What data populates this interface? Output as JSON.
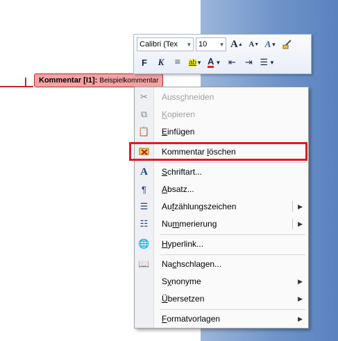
{
  "comment": {
    "label": "Kommentar [I1]:",
    "text": "Beispielkommentar"
  },
  "minibar": {
    "font_name": "Calibri (Tex",
    "font_size": "10",
    "grow_font": "A",
    "shrink_font": "A",
    "styles": "A",
    "format_painter": "format-painter",
    "bold": "F",
    "italic": "K",
    "align": "≡",
    "highlight": "ab",
    "font_color": "A",
    "decrease_indent": "⇤",
    "increase_indent": "⇥",
    "bullets": "☰"
  },
  "menu": {
    "items": [
      {
        "label": "Ausschneiden",
        "accel": "c",
        "disabled": true,
        "icon": "scissors-icon"
      },
      {
        "label": "Kopieren",
        "accel": "K",
        "disabled": true,
        "icon": "copy-icon"
      },
      {
        "label": "Einfügen",
        "accel": "E",
        "disabled": false,
        "icon": "paste-icon"
      },
      {
        "label": "Kommentar löschen",
        "accel": "l",
        "disabled": false,
        "icon": "delete-comment-icon"
      },
      {
        "label": "Schriftart...",
        "accel": "S",
        "disabled": false,
        "icon": "font-icon"
      },
      {
        "label": "Absatz...",
        "accel": "A",
        "disabled": false,
        "icon": "paragraph-icon"
      },
      {
        "label": "Aufzählungszeichen",
        "accel": "f",
        "disabled": false,
        "icon": "bullets-icon",
        "submenu": true
      },
      {
        "label": "Nummerierung",
        "accel": "m",
        "disabled": false,
        "icon": "numbering-icon",
        "submenu": true
      },
      {
        "label": "Hyperlink...",
        "accel": "H",
        "disabled": false,
        "icon": "hyperlink-icon"
      },
      {
        "label": "Nachschlagen...",
        "accel": "c",
        "disabled": false,
        "icon": "lookup-icon"
      },
      {
        "label": "Synonyme",
        "accel": "y",
        "disabled": false,
        "icon": "",
        "submenu": true
      },
      {
        "label": "Übersetzen",
        "accel": "Ü",
        "disabled": false,
        "icon": "",
        "submenu": true
      },
      {
        "label": "Formatvorlagen",
        "accel": "F",
        "disabled": false,
        "icon": "",
        "submenu": true
      }
    ],
    "arrow": "▶",
    "highlight_color": "#e01a22"
  }
}
